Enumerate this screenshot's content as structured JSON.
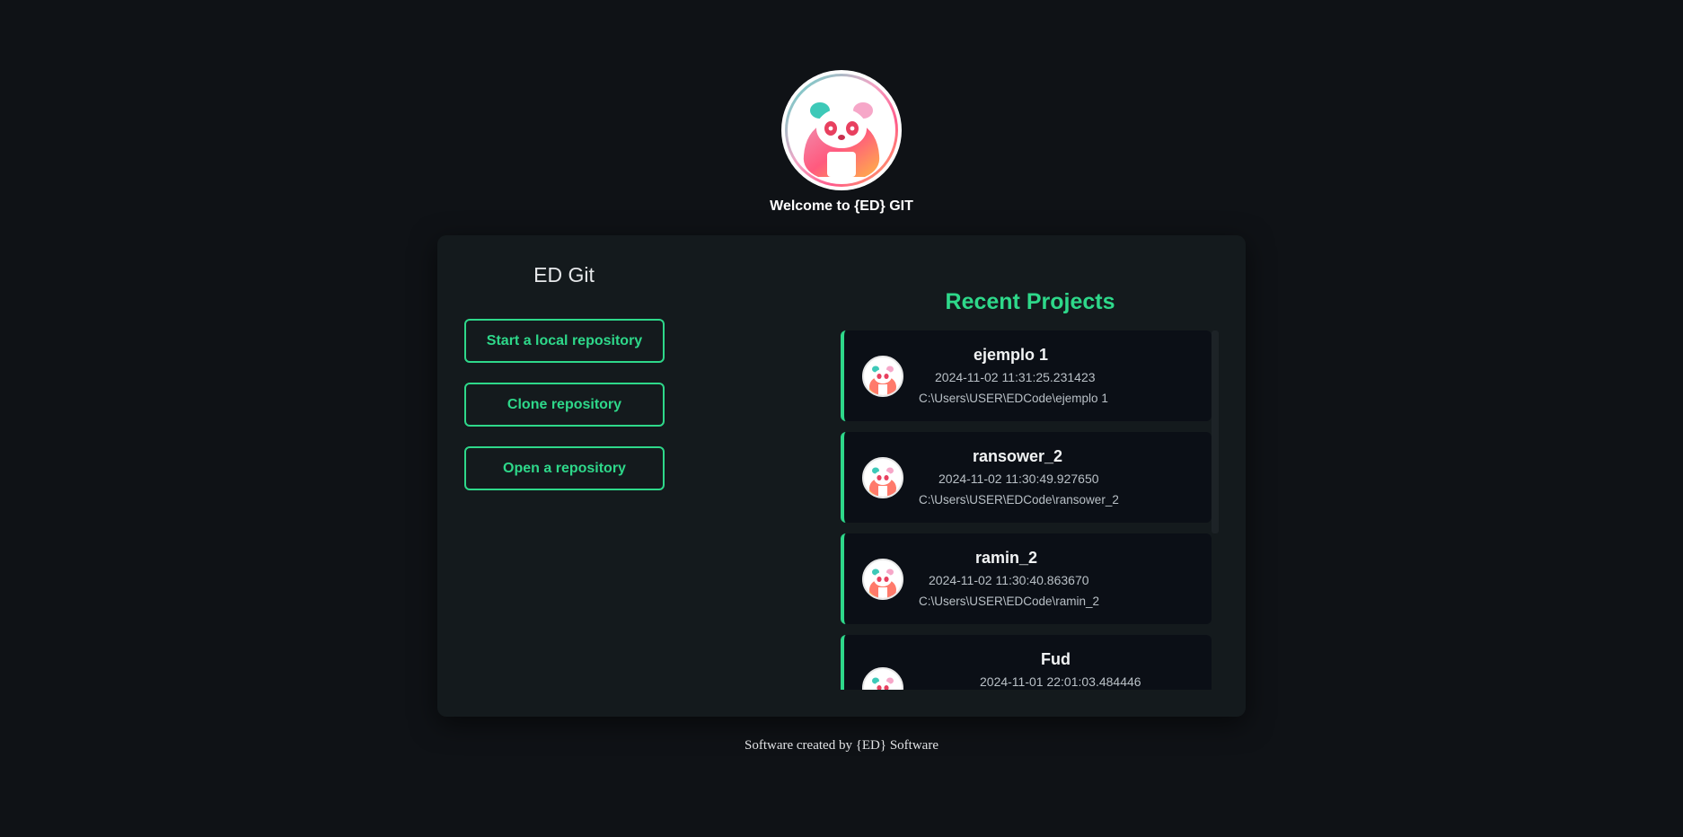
{
  "header": {
    "welcome": "Welcome to {ED} GIT"
  },
  "left": {
    "title": "ED Git",
    "buttons": [
      {
        "label": "Start a local repository"
      },
      {
        "label": "Clone repository"
      },
      {
        "label": "Open a repository"
      }
    ]
  },
  "recent": {
    "title": "Recent Projects",
    "items": [
      {
        "name": "ejemplo 1",
        "date": "2024-11-02 11:31:25.231423",
        "path": "C:\\Users\\USER\\EDCode\\ejemplo 1"
      },
      {
        "name": "ransower_2",
        "date": "2024-11-02 11:30:49.927650",
        "path": "C:\\Users\\USER\\EDCode\\ransower_2"
      },
      {
        "name": "ramin_2",
        "date": "2024-11-02 11:30:40.863670",
        "path": "C:\\Users\\USER\\EDCode\\ramin_2"
      },
      {
        "name": "Fud",
        "date": "2024-11-01 22:01:03.484446",
        "path": ""
      }
    ]
  },
  "footer": {
    "text": "Software created by {ED} Software"
  },
  "colors": {
    "background": "#0f1216",
    "card": "#141a1d",
    "accent": "#2ed88a",
    "item_bg": "#0b0f16"
  },
  "icons": {
    "logo": "panda-logo-icon",
    "project_avatar": "panda-avatar-icon"
  }
}
